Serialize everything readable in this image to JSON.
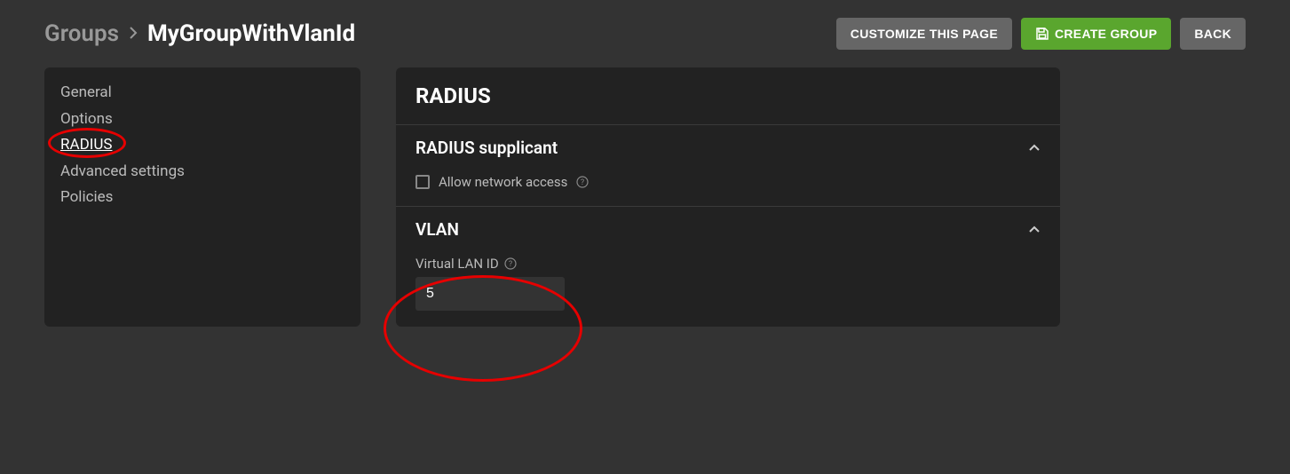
{
  "breadcrumb": {
    "root": "Groups",
    "current": "MyGroupWithVlanId"
  },
  "actions": {
    "customize": "CUSTOMIZE THIS PAGE",
    "create": "CREATE GROUP",
    "back": "BACK"
  },
  "sidebar": {
    "items": [
      {
        "label": "General"
      },
      {
        "label": "Options"
      },
      {
        "label": "RADIUS"
      },
      {
        "label": "Advanced settings"
      },
      {
        "label": "Policies"
      }
    ]
  },
  "panel": {
    "title": "RADIUS",
    "section_supplicant": {
      "title": "RADIUS supplicant",
      "allow_label": "Allow network access"
    },
    "section_vlan": {
      "title": "VLAN",
      "field_label": "Virtual LAN ID",
      "field_value": "5"
    }
  }
}
